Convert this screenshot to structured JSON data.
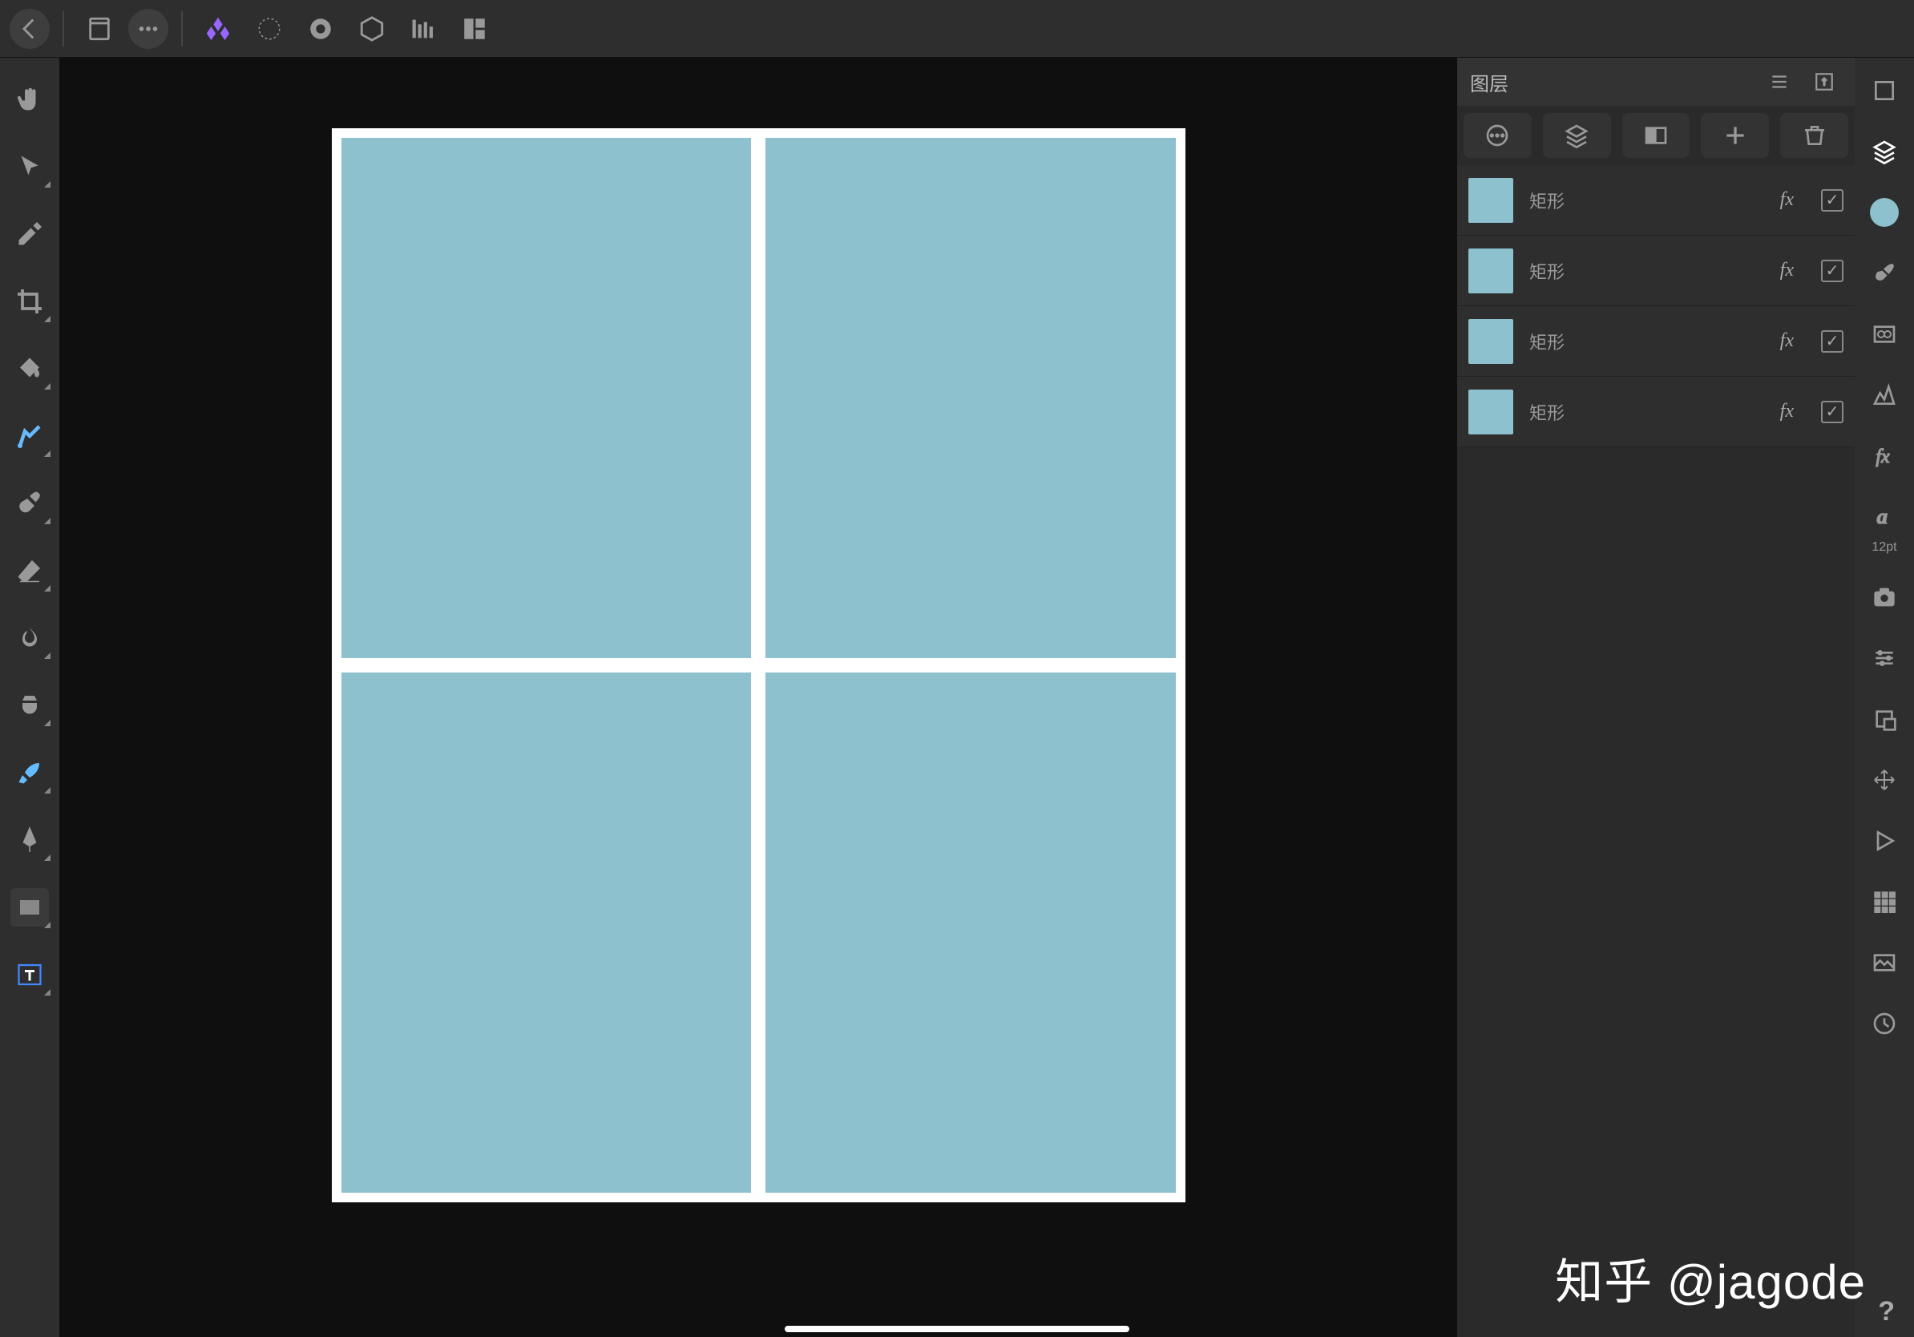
{
  "topbar": {
    "back": "back",
    "document": "document",
    "more": "more",
    "personas": [
      "photo-persona",
      "liquify-persona",
      "develop-persona",
      "tone-map-persona",
      "export-persona",
      "other-persona"
    ]
  },
  "tools": {
    "items": [
      {
        "id": "hand-tool"
      },
      {
        "id": "move-tool"
      },
      {
        "id": "color-picker-tool"
      },
      {
        "id": "crop-tool"
      },
      {
        "id": "fill-tool"
      },
      {
        "id": "inpaint-tool"
      },
      {
        "id": "paint-brush-tool"
      },
      {
        "id": "erase-tool"
      },
      {
        "id": "burn-tool"
      },
      {
        "id": "clone-tool"
      },
      {
        "id": "selection-brush-tool"
      },
      {
        "id": "pen-tool"
      },
      {
        "id": "rectangle-tool"
      },
      {
        "id": "text-tool"
      }
    ]
  },
  "canvas": {
    "fill": "#8cc1cd",
    "rects": 4
  },
  "panel": {
    "title": "图层",
    "list_btn": "list",
    "pin_btn": "pin",
    "ops": [
      "layer-options",
      "merge",
      "mask",
      "add",
      "delete"
    ],
    "layers": [
      {
        "name": "矩形",
        "fx": "fx",
        "checked": true
      },
      {
        "name": "矩形",
        "fx": "fx",
        "checked": true
      },
      {
        "name": "矩形",
        "fx": "fx",
        "checked": true
      },
      {
        "name": "矩形",
        "fx": "fx",
        "checked": true
      }
    ]
  },
  "right": {
    "font_size": "12pt",
    "items": [
      "expand",
      "layers-studio",
      "color",
      "brush",
      "channels",
      "histogram",
      "text-styles",
      "adjustments",
      "transform",
      "photo",
      "navigator",
      "swatches",
      "assets",
      "history"
    ]
  },
  "watermark": "知乎 @jagode",
  "help": "?"
}
